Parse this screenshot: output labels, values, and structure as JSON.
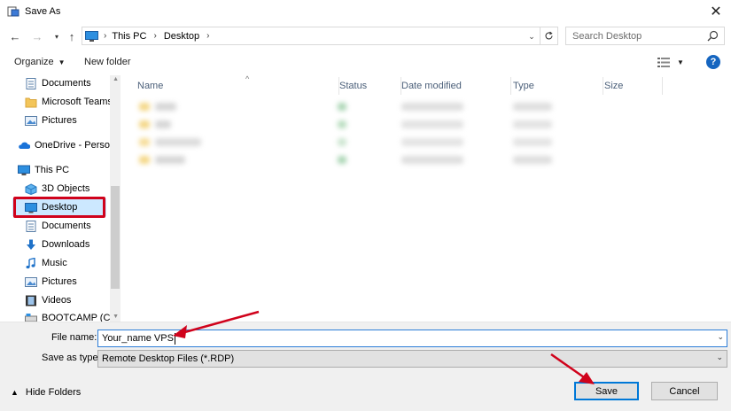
{
  "window": {
    "title": "Save As",
    "close_icon": "close-icon"
  },
  "address_bar": {
    "breadcrumbs": [
      "This PC",
      "Desktop"
    ],
    "search_placeholder": "Search Desktop"
  },
  "toolbar": {
    "organize_label": "Organize",
    "new_folder_label": "New folder",
    "help_label": "?"
  },
  "nav_pane": {
    "items": [
      {
        "label": "Documents",
        "icon": "documents-icon"
      },
      {
        "label": "Microsoft Teams",
        "icon": "folder-icon"
      },
      {
        "label": "Pictures",
        "icon": "pictures-icon"
      },
      {
        "label": "OneDrive - Person",
        "icon": "onedrive-icon"
      },
      {
        "label": "This PC",
        "icon": "pc-icon"
      },
      {
        "label": "3D Objects",
        "icon": "3d-objects-icon"
      },
      {
        "label": "Desktop",
        "icon": "desktop-icon"
      },
      {
        "label": "Documents",
        "icon": "documents-icon"
      },
      {
        "label": "Downloads",
        "icon": "downloads-icon"
      },
      {
        "label": "Music",
        "icon": "music-icon"
      },
      {
        "label": "Pictures",
        "icon": "pictures-icon"
      },
      {
        "label": "Videos",
        "icon": "videos-icon"
      },
      {
        "label": "BOOTCAMP (C:)",
        "icon": "drive-icon"
      }
    ],
    "selected": "Desktop"
  },
  "file_list": {
    "columns": [
      "Name",
      "Status",
      "Date modified",
      "Type",
      "Size"
    ]
  },
  "form": {
    "file_name_label": "File name:",
    "file_name_value": "Your_name VPS",
    "save_as_type_label": "Save as type:",
    "save_as_type_value": "Remote Desktop Files (*.RDP)"
  },
  "footer": {
    "hide_folders_label": "Hide Folders",
    "save_label": "Save",
    "cancel_label": "Cancel"
  },
  "colors": {
    "accent": "#0078d7",
    "selection": "#cce8ff",
    "annotation_red": "#d0021b"
  }
}
